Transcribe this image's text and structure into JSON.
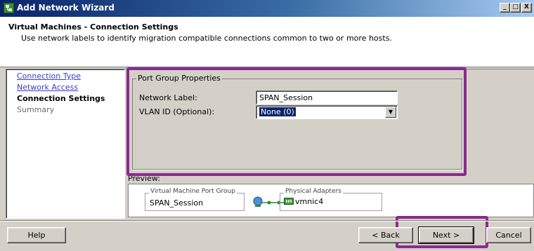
{
  "window": {
    "title": "Add Network Wizard",
    "controls": {
      "minimize": "_",
      "maximize": "□",
      "close": "X"
    }
  },
  "header": {
    "title": "Virtual Machines - Connection Settings",
    "subtitle": "Use network labels to identify migration compatible connections common to two or more hosts."
  },
  "nav": {
    "items": [
      {
        "label": "Connection Type",
        "state": "link"
      },
      {
        "label": "Network Access",
        "state": "link"
      },
      {
        "label": "Connection Settings",
        "state": "current"
      },
      {
        "label": "Summary",
        "state": "disabled"
      }
    ]
  },
  "port_group": {
    "legend": "Port Group Properties",
    "network_label": {
      "label": "Network Label:",
      "value": "SPAN_Session"
    },
    "vlan_id": {
      "label": "VLAN ID (Optional):",
      "value": "None (0)"
    }
  },
  "preview": {
    "label": "Preview:",
    "vm_port_group_legend": "Virtual Machine Port Group",
    "vm_port_group_name": "SPAN_Session",
    "physical_adapters_legend": "Physical Adapters",
    "adapter_name": "vmnic4"
  },
  "buttons": {
    "help": "Help",
    "back": "< Back",
    "next": "Next >",
    "cancel": "Cancel"
  },
  "colors": {
    "highlight": "#8b2a8f",
    "link": "#3b3bc7",
    "titlebar_start": "#0a246a"
  }
}
